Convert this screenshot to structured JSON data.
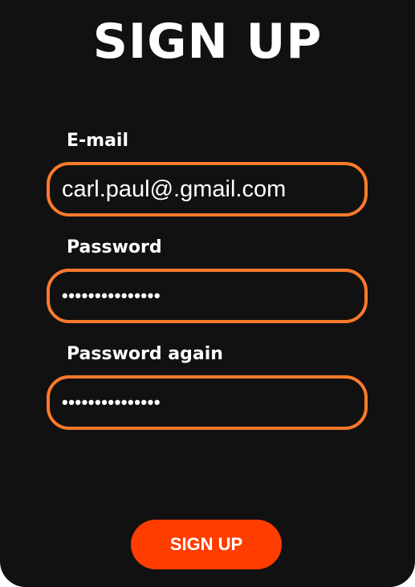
{
  "form": {
    "title": "SIGN UP",
    "email": {
      "label": "E-mail",
      "value": "carl.paul@.gmail.com"
    },
    "password": {
      "label": "Password",
      "value": "•••••••••••••••"
    },
    "password_again": {
      "label": "Password again",
      "value": "•••••••••••••••"
    },
    "submit_label": "SIGN UP"
  },
  "colors": {
    "background": "#111111",
    "field_border": "#ff7a2a",
    "button": "#ff3d00",
    "text": "#ffffff"
  }
}
